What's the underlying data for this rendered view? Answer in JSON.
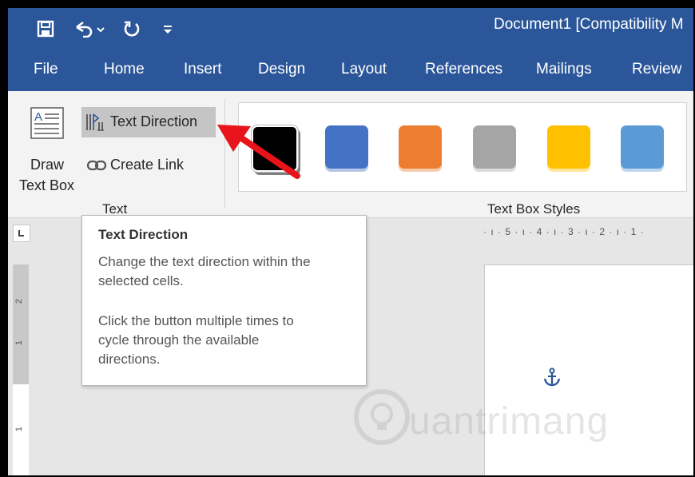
{
  "window": {
    "title": "Document1 [Compatibility M"
  },
  "qat": {
    "save_icon": "floppy-disk-icon",
    "undo_icon": "undo-icon",
    "redo_icon": "repeat-icon",
    "customize_icon": "qat-customize-icon"
  },
  "tabs": [
    "File",
    "Home",
    "Insert",
    "Design",
    "Layout",
    "References",
    "Mailings",
    "Review"
  ],
  "ribbon": {
    "draw_text_box": [
      "Draw",
      "Text Box"
    ],
    "text_direction": "Text Direction",
    "create_link": "Create Link",
    "text_group": "Text",
    "text_box_styles_group": "Text Box Styles",
    "swatches": [
      "#000000",
      "#4472c4",
      "#ed7d31",
      "#a5a5a5",
      "#ffc000",
      "#5b9bd5"
    ]
  },
  "ruler": {
    "horizontal": "· ı · 5 · ı · 4 · ı · 3 · ı · 2 · ı · 1 ·",
    "vertical_marks": [
      "2",
      "1",
      "1"
    ]
  },
  "tooltip": {
    "title": "Text Direction",
    "body1": [
      "Change the text direction within the",
      "selected cells."
    ],
    "body2": [
      "Click the button multiple times to",
      "cycle through the available",
      "directions."
    ]
  },
  "watermark": {
    "text": "uantrimang"
  },
  "colors": {
    "titlebar": "#2b579a",
    "annotation_arrow": "#e8141b"
  }
}
